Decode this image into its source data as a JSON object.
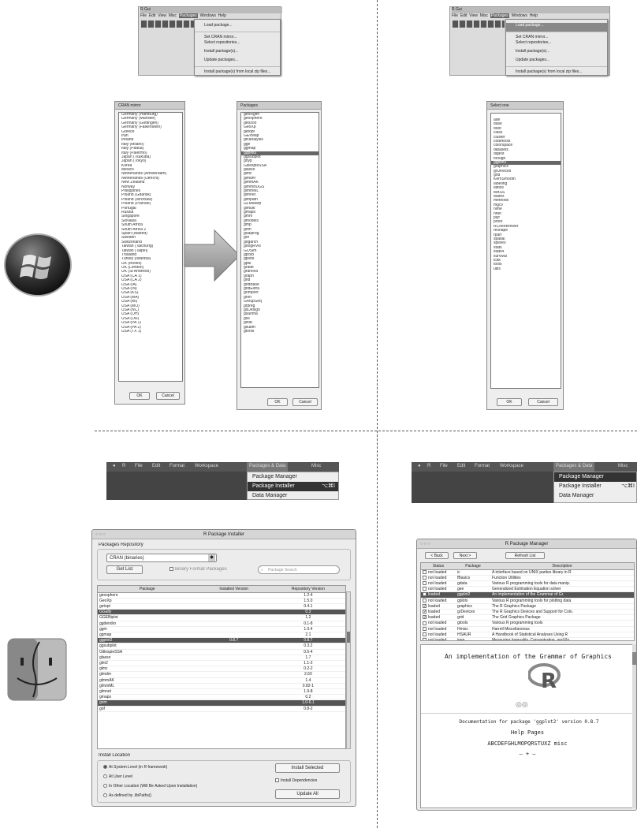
{
  "win_menubar": {
    "title": "R Gui",
    "menus": [
      "File",
      "Edit",
      "View",
      "Misc",
      "Packages",
      "Windows",
      "Help"
    ],
    "packages_menu": [
      "Load package...",
      "Set CRAN mirror...",
      "Select repositories...",
      "Install package(s)...",
      "Update packages...",
      "Install package(s) from local zip files..."
    ]
  },
  "cran_mirror": {
    "title": "CRAN mirror",
    "items": [
      "Germany (Hamburg)",
      "Germany (Münster)",
      "Germany (Göttingen)",
      "Germany (Falkenstein)",
      "Greece",
      "Iran",
      "Ireland",
      "Italy (Milano)",
      "Italy (Padua)",
      "Italy (Palermo)",
      "Japan (Tsukuba)",
      "Japan (Tokyo)",
      "Korea",
      "Mexico",
      "Netherlands (Amsterdam)",
      "Netherlands (Utrecht)",
      "New Zealand",
      "Norway",
      "Philippines",
      "Poland (Gdansk)",
      "Poland (Wroclaw)",
      "Poland (Poznan)",
      "Portugal",
      "Russia",
      "Singapore",
      "Slovakia",
      "South Africa",
      "South Africa 2",
      "Spain (Madrid)",
      "Sweden",
      "Switzerland",
      "Taiwan (Taichung)",
      "Taiwan (Taipei)",
      "Thailand",
      "Turkey (Istanbul)",
      "UK (Bristol)",
      "UK (London)",
      "UK (St Andrews)",
      "USA (CA 1)",
      "USA (CA 2)",
      "USA (IA)",
      "USA (IN)",
      "USA (KS)",
      "USA (MA)",
      "USA (MI)",
      "USA (MO)",
      "USA (NC)",
      "USA (OH)",
      "USA (OR)",
      "USA (PA 1)",
      "USA (PA 2)",
      "USA (TX 1)"
    ],
    "ok": "OK",
    "cancel": "Cancel"
  },
  "packages_list": {
    "title": "Packages",
    "items": [
      "geoRglm",
      "geosphere",
      "geozoo",
      "GeoXp",
      "getopt",
      "GExMap",
      "gfcanalysis",
      "gge",
      "ggmap",
      "ggplot2",
      "ggsubplot",
      "ghyp",
      "GillespieSSA",
      "glasso",
      "glmc",
      "glmdm",
      "glmmAK",
      "glmmBUGS",
      "glmmML",
      "glmnet",
      "glmpath",
      "GLMMarp",
      "glmulti",
      "gmaps",
      "gmm",
      "gmodels",
      "gmp",
      "gnm",
      "goalprog",
      "gof",
      "gogarch",
      "googleVis",
      "GOSim",
      "gpclib",
      "gplots",
      "gptk",
      "grade",
      "granova",
      "graph",
      "grid",
      "gridBase",
      "gridExtra",
      "grImport",
      "grnn",
      "GroupSeq",
      "grpreg",
      "gsDesign",
      "gsarima",
      "gss",
      "gstat",
      "gsubfn",
      "gtools"
    ],
    "selected_index": 9,
    "ok": "OK",
    "cancel": "Cancel"
  },
  "select_one": {
    "title": "Select one",
    "items": [
      "ade",
      "base",
      "boot",
      "class",
      "cluster",
      "codetools",
      "colorspace",
      "datasets",
      "digest",
      "foreign",
      "ggplot2",
      "graphics",
      "grDevices",
      "grid",
      "KernSmooth",
      "labeling",
      "lattice",
      "MASS",
      "Matrix",
      "methods",
      "mgcv",
      "nlme",
      "nnet",
      "plyr",
      "proto",
      "RColorBrewer",
      "reshape",
      "rpart",
      "spatial",
      "splines",
      "stats",
      "stats4",
      "survival",
      "tcltk",
      "tools",
      "utils"
    ],
    "selected_index": 10,
    "ok": "OK",
    "cancel": "Cancel"
  },
  "mac_menubar_left": {
    "items": [
      "R",
      "File",
      "Edit",
      "Format",
      "Workspace",
      "Packages & Data",
      "Misc"
    ],
    "dropdown": [
      "Package Manager",
      "Package Installer",
      "Data Manager"
    ],
    "shortcut": "⌥⌘I",
    "highlighted": "Package Installer"
  },
  "mac_menubar_right": {
    "items": [
      "R",
      "File",
      "Edit",
      "Format",
      "Workspace",
      "Packages & Data",
      "Misc"
    ],
    "dropdown": [
      "Package Manager",
      "Package Installer",
      "Data Manager"
    ],
    "shortcut": "⌥⌘I",
    "highlighted": "Package Manager"
  },
  "installer": {
    "title": "R Package Installer",
    "repo_label": "Packages Repository",
    "repo_value": "CRAN (binaries)",
    "get_list": "Get List",
    "format_label": "Binary Format Packages",
    "search_placeholder": "Package Search",
    "columns": [
      "Package",
      "Installed Version",
      "Repository Version"
    ],
    "rows": [
      [
        "geosphere",
        "",
        "1.2-4"
      ],
      [
        "GeoXp",
        "",
        "1.5.0"
      ],
      [
        "getopt",
        "",
        "0.4.1"
      ],
      [
        "GGally",
        "",
        "0.3"
      ],
      [
        "GGEBiplot",
        "",
        "1.2"
      ],
      [
        "ggdendro",
        "",
        "0.1-8"
      ],
      [
        "ggm",
        "",
        "1.0.4"
      ],
      [
        "ggmap",
        "",
        "2.1"
      ],
      [
        "ggplot2",
        "0.8.7",
        "0.8.7"
      ],
      [
        "ggsubplot",
        "",
        "0.3.2"
      ],
      [
        "GillespieSSA",
        "",
        "0.5-4"
      ],
      [
        "glasso",
        "",
        "1.7"
      ],
      [
        "glm2",
        "",
        "1.1-2"
      ],
      [
        "glmc",
        "",
        "0.2-2"
      ],
      [
        "glmdm",
        "",
        "2.60"
      ],
      [
        "glmmAK",
        "",
        "1.4"
      ],
      [
        "glmmML",
        "",
        "0.82-1"
      ],
      [
        "glmnet",
        "",
        "1.9-8"
      ],
      [
        "gmaps",
        "",
        "0.2"
      ],
      [
        "gnm",
        "",
        "1.0-6.1"
      ],
      [
        "gof",
        "",
        "0.8-2"
      ]
    ],
    "selected_rows": [
      3,
      8,
      19
    ],
    "install_location_label": "Install Location",
    "locations": [
      "At System Level (in R framework)",
      "At User Level",
      "In Other Location (Will Be Asked Upon Installation)",
      "As defined by .libPaths()"
    ],
    "install_selected": "Install Selected",
    "install_deps": "Install Dependencies",
    "update_all": "Update All"
  },
  "manager": {
    "title": "R Package Manager",
    "back": "< Back",
    "forward": "Next >",
    "refresh": "Refresh List",
    "columns": [
      "Status",
      "Package",
      "Description"
    ],
    "rows": [
      {
        "checked": false,
        "status": "not loaded",
        "pkg": "ic",
        "desc": "A interface based on UNIX parties library in R"
      },
      {
        "checked": false,
        "status": "not loaded",
        "pkg": "fBasics",
        "desc": "Function Utilities"
      },
      {
        "checked": false,
        "status": "not loaded",
        "pkg": "gdata",
        "desc": "Various R programming tools for data manip."
      },
      {
        "checked": false,
        "status": "not loaded",
        "pkg": "gee",
        "desc": "Generalized Estimation Equation solver"
      },
      {
        "checked": true,
        "status": "loaded",
        "pkg": "ggplot2",
        "desc": "An implementation of the Grammar of Gr."
      },
      {
        "checked": false,
        "status": "not loaded",
        "pkg": "gplots",
        "desc": "Various R programming tools for plotting data"
      },
      {
        "checked": true,
        "status": "loaded",
        "pkg": "graphics",
        "desc": "The R Graphics Package"
      },
      {
        "checked": true,
        "status": "loaded",
        "pkg": "grDevices",
        "desc": "The R Graphics Devices and Support for Colo."
      },
      {
        "checked": true,
        "status": "loaded",
        "pkg": "grid",
        "desc": "The Grid Graphics Package"
      },
      {
        "checked": false,
        "status": "not loaded",
        "pkg": "gtools",
        "desc": "Various R programming tools"
      },
      {
        "checked": false,
        "status": "not loaded",
        "pkg": "Hmisc",
        "desc": "Harrell Miscellaneous"
      },
      {
        "checked": false,
        "status": "not loaded",
        "pkg": "HSAUR",
        "desc": "A Handbook of Statistical Analyses Using R"
      },
      {
        "checked": false,
        "status": "not loaded",
        "pkg": "ineq",
        "desc": "Measuring Inequality, Concentration, and Po."
      }
    ],
    "selected_row": 4,
    "doc_heading": "An implementation of the Grammar of Graphics",
    "doc_line": "Documentation for package 'ggplot2' version 0.8.7",
    "help_pages": "Help Pages",
    "alphabet": "ABCDEFGHLMOPQRSTUXZ misc",
    "rlogo": "R"
  },
  "os_icons": {
    "windows": "windows-logo-icon",
    "mac": "mac-finder-icon"
  }
}
